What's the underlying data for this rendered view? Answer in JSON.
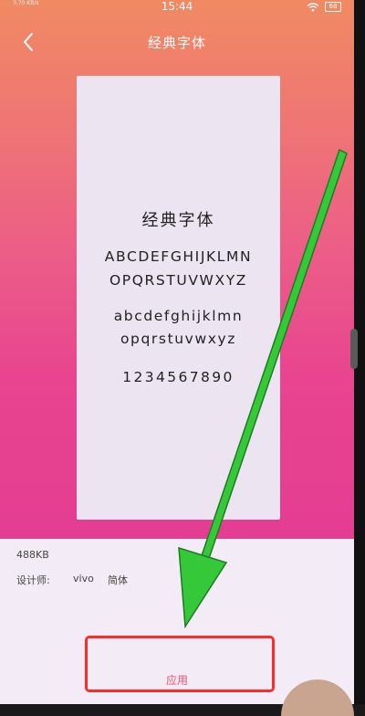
{
  "status_bar": {
    "left_text": "3.70 KB/s",
    "time": "15:44",
    "battery": "68"
  },
  "header": {
    "title": "经典字体"
  },
  "preview": {
    "title": "经典字体",
    "upper_line1": "ABCDEFGHIJKLMN",
    "upper_line2": "OPQRSTUVWXYZ",
    "lower_line1": "abcdefghijklmn",
    "lower_line2": "opqrstuvwxyz",
    "digits": "1234567890"
  },
  "info": {
    "file_size": "488KB",
    "designer_label": "设计师:",
    "designer_name": "vivo",
    "font_style": "简体"
  },
  "actions": {
    "apply_label": "应用"
  },
  "colors": {
    "gradient_top": "#f08a63",
    "gradient_bottom": "#e43d92",
    "apply_text": "#e9576f",
    "highlight_border": "#ff2a2a",
    "arrow": "#35c93a"
  },
  "icons": {
    "back": "back-arrow-icon",
    "wifi": "wifi-icon",
    "battery": "battery-icon"
  }
}
